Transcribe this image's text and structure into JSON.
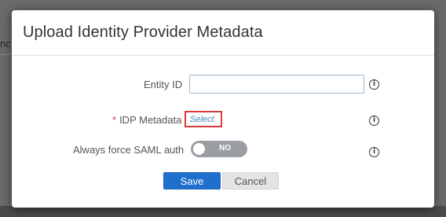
{
  "background": {
    "partial_text": "nc"
  },
  "dialog": {
    "title": "Upload Identity Provider Metadata",
    "fields": {
      "entity_id": {
        "label": "Entity ID",
        "value": "",
        "placeholder": ""
      },
      "idp_metadata": {
        "required_mark": "*",
        "label": "IDP Metadata",
        "link": "Select"
      },
      "force_saml": {
        "label": "Always force SAML auth",
        "toggle_text": "NO",
        "enabled": false
      }
    },
    "info_glyph": "i",
    "buttons": {
      "save": "Save",
      "cancel": "Cancel"
    }
  },
  "colors": {
    "primary": "#1f6fcc",
    "highlight_border": "#d93b3b",
    "link": "#4a86c5",
    "toggle_off": "#9a9ea2"
  }
}
